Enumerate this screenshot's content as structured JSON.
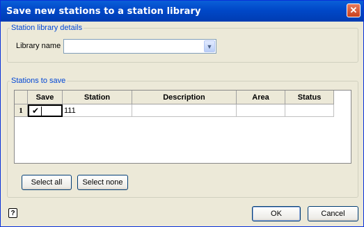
{
  "window": {
    "title": "Save new stations to a station library"
  },
  "library_group": {
    "legend": "Station library details",
    "library_name_label": "Library name",
    "library_name_value": ""
  },
  "stations_group": {
    "legend": "Stations to save",
    "columns": [
      "Save",
      "Station",
      "Description",
      "Area",
      "Status"
    ],
    "rows": [
      {
        "row_number": "1",
        "save": "✔",
        "station": "111",
        "description": "",
        "area": "",
        "status": ""
      }
    ]
  },
  "buttons": {
    "select_all": "Select all",
    "select_none": "Select none",
    "ok": "OK",
    "cancel": "Cancel"
  },
  "icons": {
    "close": "close-icon",
    "dropdown": "chevron-down-icon",
    "help": "help-icon",
    "check": "checkmark-icon"
  },
  "colors": {
    "title_bar": "#0048c8",
    "group_legend": "#0046d5",
    "dialog_bg": "#ece9d8"
  }
}
